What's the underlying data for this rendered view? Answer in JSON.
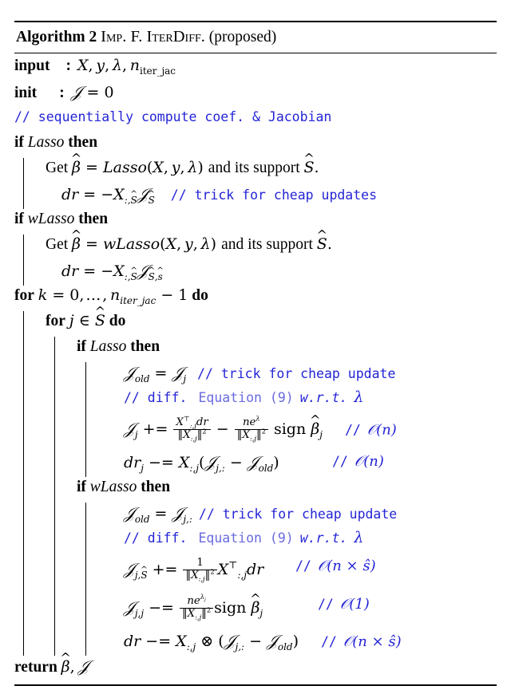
{
  "algorithm": {
    "number_label": "Algorithm 2",
    "title_smallcaps": "Imp. F. IterDiff.",
    "title_suffix": "(proposed)",
    "header": {
      "input_keyword": "input",
      "input_colon": ":",
      "input_args": "X, y, λ, n_iter_jac",
      "init_keyword": "init",
      "init_colon": ":",
      "init_value": "𝒥 = 0"
    },
    "comments": {
      "sequential": "// sequentially compute coef.  & Jacobian",
      "trick_updates": "// trick for cheap updates",
      "trick_update": "// trick for cheap update",
      "diff_prefix": "// diff.",
      "diff_equation_link": "Equation (9)",
      "diff_suffix": "w.r.t.",
      "diff_lambda": "λ"
    },
    "complexity": {
      "o_n": "𝒪(n)",
      "o_1": "𝒪(1)",
      "o_n_s": "𝒪(n × ŝ)"
    },
    "keywords": {
      "if": "if",
      "then": "then",
      "for": "for",
      "do": "do",
      "return": "return",
      "get": "Get",
      "and_its_support": "and its support",
      "sign": "sign",
      "lasso": "Lasso",
      "wlasso": "wLasso"
    },
    "lines": {
      "lasso_get": "Get β̂ = Lasso(X, y, λ) and its support Ŝ.",
      "lasso_dr": "dr = −X_{:,Ŝ} 𝒥_{Ŝ}",
      "wlasso_get": "Get β̂ = wLasso(X, y, λ) and its support Ŝ.",
      "wlasso_dr": "dr = −X_{:,Ŝ} 𝒥_{Ŝ,ŝ}",
      "for_k": "for k = 0, … , n_iter_jac − 1 do",
      "for_j": "for j ∈ Ŝ do",
      "jold_j": "𝒥_old = 𝒥_j",
      "jold_jrow": "𝒥_old = 𝒥_{j,:}",
      "update_J": "𝒥_j += Xᵀ_{:,j} dr / ‖X_{:,j}‖² − ne^λ / ‖X_{:,j}‖² sign β̂_j",
      "update_dr_j": "dr_j −= X_{:,j}(𝒥_{j,:} − 𝒥_old)",
      "update_J_jS": "𝒥_{j,Ŝ} += 1 / ‖X_{:,j}‖² Xᵀ_{:,j} dr",
      "update_J_jj": "𝒥_{j,j} −= ne^{λ_j} / ‖X_{:,j}‖² sign β̂_j",
      "update_dr": "dr −= X_{:,j} ⊗ (𝒥_{j,:} − 𝒥_old)",
      "return_value": "β̂, 𝒥"
    }
  },
  "colors": {
    "comment_blue": "#2424d6",
    "link_blue": "#6a6ae0",
    "text_black": "#000000",
    "background": "#ffffff"
  }
}
